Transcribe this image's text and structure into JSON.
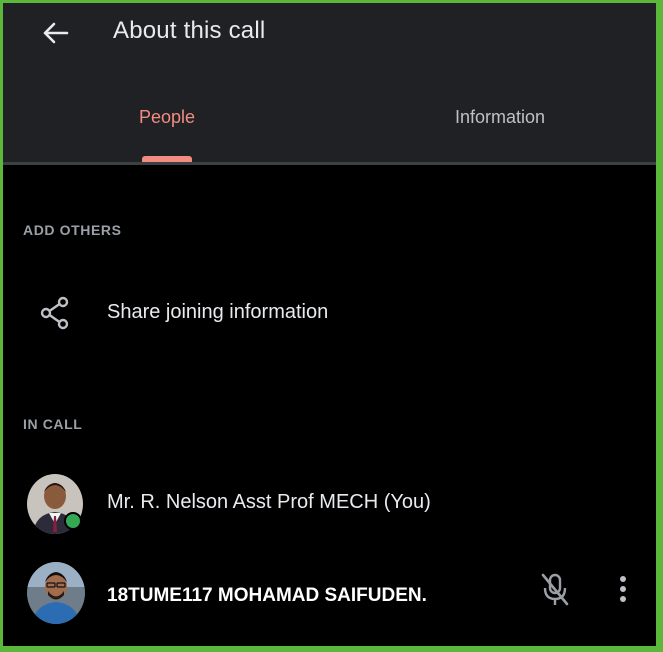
{
  "header": {
    "back_icon": "arrow-left-icon",
    "title": "About this call"
  },
  "tabs": [
    {
      "label": "People",
      "active": true
    },
    {
      "label": "Information",
      "active": false
    }
  ],
  "add_others": {
    "section_label": "ADD OTHERS",
    "share_label": "Share joining information",
    "share_icon": "share-icon"
  },
  "in_call": {
    "section_label": "IN CALL",
    "participants": [
      {
        "name": "Mr. R. Nelson Asst Prof MECH (You)",
        "status": "active"
      },
      {
        "name": "18TUME117 MOHAMAD SAIFUDEN.",
        "mic": "muted"
      }
    ]
  },
  "colors": {
    "accent": "#f28b82",
    "header_bg": "#202124",
    "body_bg": "#000000",
    "border": "#5cb83a",
    "status_green": "#34a853"
  }
}
